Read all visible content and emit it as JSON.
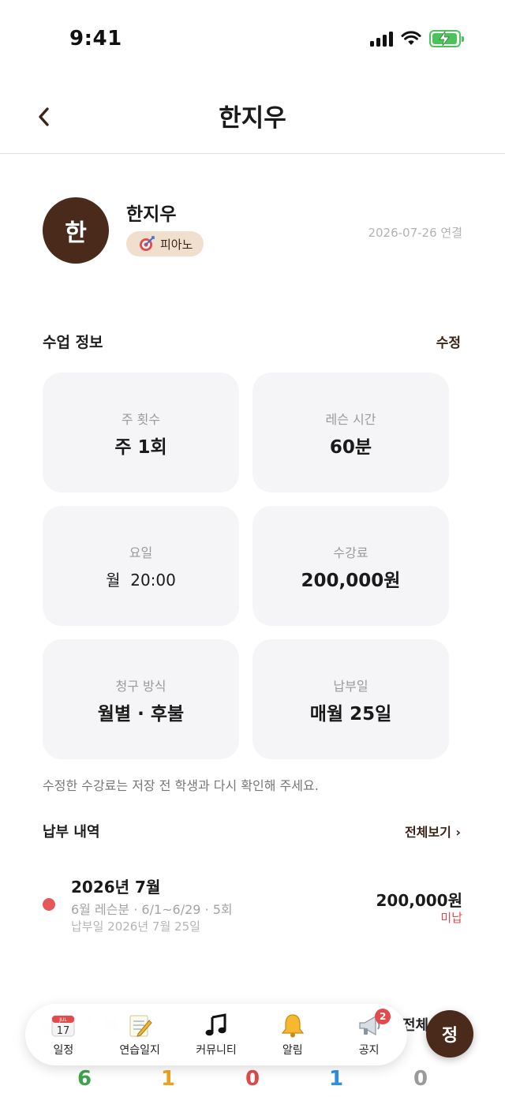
{
  "status_bar": {
    "time": "9:41"
  },
  "header": {
    "back_icon": "chevron-left-icon",
    "title": "한지우"
  },
  "profile": {
    "avatar_initial": "한",
    "name": "한지우",
    "subject_icon": "target-icon",
    "subject": "피아노",
    "connected_date": "2026-07-26 연결"
  },
  "lesson_info": {
    "title": "수업 정보",
    "edit_label": "수정",
    "cards": [
      {
        "label": "주 횟수",
        "value": "주 1회"
      },
      {
        "label": "레슨 시간",
        "value": "60분"
      },
      {
        "label": "요일",
        "value": "월  20:00"
      },
      {
        "label": "수강료",
        "value": "200,000원"
      },
      {
        "label": "청구 방식",
        "value": "월별 · 후불"
      },
      {
        "label": "납부일",
        "value": "매월 25일"
      }
    ],
    "notice": "수정한 수강료는 저장 전 학생과 다시 확인해 주세요."
  },
  "payments": {
    "title": "납부 내역",
    "view_all_label": "전체보기 ›",
    "items": [
      {
        "month": "2026년 7월",
        "detail": "6월 레슨분 · 6/1~6/29 · 5회",
        "due": "납부일 2026년 7월 25일",
        "amount": "200,000원",
        "status": "미납",
        "status_color": "#e0494b"
      }
    ]
  },
  "tab_bar": {
    "tabs": [
      {
        "label": "일정",
        "icon": "calendar-icon"
      },
      {
        "label": "연습일지",
        "icon": "notepad-icon"
      },
      {
        "label": "커뮤니티",
        "icon": "music-note-icon"
      },
      {
        "label": "알림",
        "icon": "bell-icon"
      },
      {
        "label": "공지",
        "icon": "megaphone-icon",
        "badge": "2"
      }
    ],
    "fab_label": "정"
  },
  "background": {
    "partial_text": "전체",
    "counts": [
      {
        "value": "6",
        "color": "#3fa34d"
      },
      {
        "value": "1",
        "color": "#f0a020"
      },
      {
        "value": "0",
        "color": "#e0494b"
      },
      {
        "value": "1",
        "color": "#2f8fe0"
      },
      {
        "value": "0",
        "color": "#9a9a9a"
      }
    ]
  },
  "colors": {
    "brand": "#4a2a1a",
    "chip": "#f1dfcd",
    "card": "#f5f5f7",
    "alert": "#e0494b"
  }
}
